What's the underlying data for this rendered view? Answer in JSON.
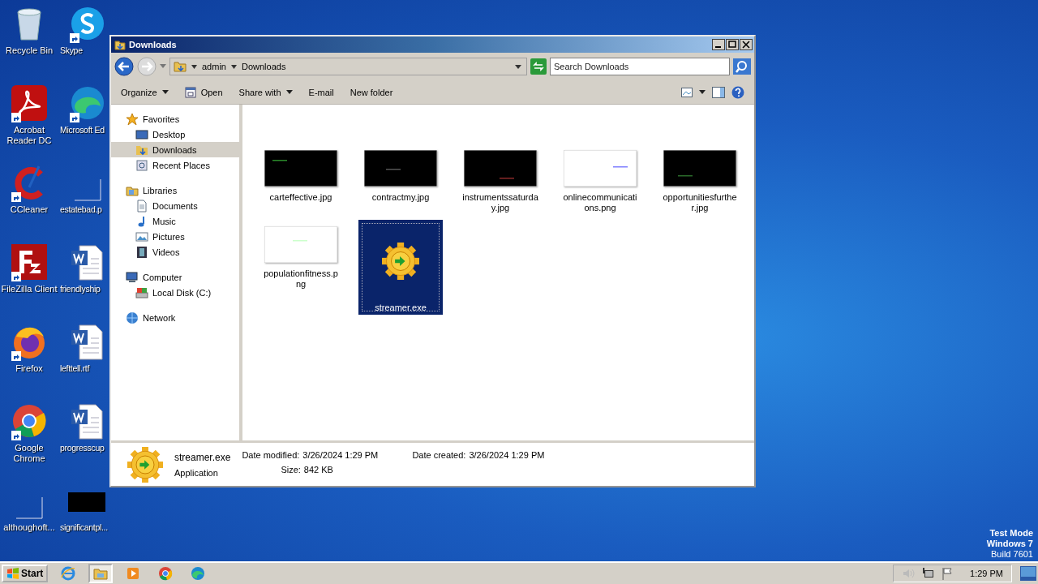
{
  "desktop": {
    "icons": [
      {
        "label": "Recycle Bin",
        "kind": "bin",
        "shortcut": false
      },
      {
        "label": "Skype",
        "kind": "skype",
        "shortcut": true
      },
      {
        "label": "Acrobat Reader DC",
        "kind": "acrobat",
        "shortcut": true
      },
      {
        "label": "Microsoft Ed",
        "kind": "edge",
        "shortcut": true
      },
      {
        "label": "CCleaner",
        "kind": "ccleaner",
        "shortcut": true
      },
      {
        "label": "estatebad.p",
        "kind": "blank",
        "shortcut": false
      },
      {
        "label": "FileZilla Client",
        "kind": "filezilla",
        "shortcut": true
      },
      {
        "label": "friendlyship",
        "kind": "word",
        "shortcut": false
      },
      {
        "label": "Firefox",
        "kind": "firefox",
        "shortcut": true
      },
      {
        "label": "lefttell.rtf",
        "kind": "word",
        "shortcut": false
      },
      {
        "label": "Google Chrome",
        "kind": "chrome",
        "shortcut": true
      },
      {
        "label": "progresscup",
        "kind": "word",
        "shortcut": false
      },
      {
        "label": "althoughoft...",
        "kind": "blank",
        "shortcut": false
      },
      {
        "label": "significantpl...",
        "kind": "black",
        "shortcut": false
      }
    ],
    "watermark": [
      "Test Mode",
      "Windows 7",
      "Build 7601"
    ]
  },
  "window": {
    "title": "Downloads",
    "address": {
      "crumbs": [
        "admin",
        "Downloads"
      ]
    },
    "search": {
      "placeholder": "Search Downloads"
    },
    "toolbar": [
      {
        "label": "Organize",
        "menu": true,
        "icon": false
      },
      {
        "label": "Open",
        "menu": false,
        "icon": true
      },
      {
        "label": "Share with",
        "menu": true,
        "icon": false
      },
      {
        "label": "E-mail",
        "menu": false,
        "icon": false
      },
      {
        "label": "New folder",
        "menu": false,
        "icon": false
      }
    ],
    "nav": [
      {
        "label": "Favorites",
        "kind": "star",
        "selected": false,
        "children": [
          {
            "label": "Desktop",
            "kind": "desktop",
            "selected": false
          },
          {
            "label": "Downloads",
            "kind": "downloads",
            "selected": true
          },
          {
            "label": "Recent Places",
            "kind": "recent",
            "selected": false
          }
        ]
      },
      {
        "label": "Libraries",
        "kind": "libraries",
        "selected": false,
        "children": [
          {
            "label": "Documents",
            "kind": "documents",
            "selected": false
          },
          {
            "label": "Music",
            "kind": "music",
            "selected": false
          },
          {
            "label": "Pictures",
            "kind": "pictures",
            "selected": false
          },
          {
            "label": "Videos",
            "kind": "videos",
            "selected": false
          }
        ]
      },
      {
        "label": "Computer",
        "kind": "computer",
        "selected": false,
        "children": [
          {
            "label": "Local Disk (C:)",
            "kind": "disk",
            "selected": false
          }
        ]
      },
      {
        "label": "Network",
        "kind": "network",
        "selected": false
      }
    ],
    "files": [
      {
        "name": "carteffective.jpg",
        "kind": "dark",
        "selected": false
      },
      {
        "name": "contractmy.jpg",
        "kind": "dark",
        "selected": false
      },
      {
        "name": "instrumentssaturday.jpg",
        "kind": "dark",
        "selected": false
      },
      {
        "name": "onlinecommunications.png",
        "kind": "light",
        "selected": false
      },
      {
        "name": "opportunitiesfurther.jpg",
        "kind": "dark",
        "selected": false
      },
      {
        "name": "populationfitness.png",
        "kind": "light",
        "selected": false
      },
      {
        "name": "streamer.exe",
        "kind": "app",
        "selected": true
      }
    ],
    "details": {
      "name": "streamer.exe",
      "type": "Application",
      "fields": [
        {
          "label": "Date modified:",
          "value": "3/26/2024 1:29 PM"
        },
        {
          "label": "Date created:",
          "value": "3/26/2024 1:29 PM"
        },
        {
          "label": "Size:",
          "value": "842 KB"
        }
      ]
    }
  },
  "taskbar": {
    "start": "Start",
    "apps": [
      {
        "kind": "ie",
        "selected": false
      },
      {
        "kind": "explorer",
        "selected": true
      },
      {
        "kind": "media",
        "selected": false
      },
      {
        "kind": "chrome",
        "selected": false
      },
      {
        "kind": "edge",
        "selected": false
      }
    ],
    "clock": "1:29 PM"
  }
}
